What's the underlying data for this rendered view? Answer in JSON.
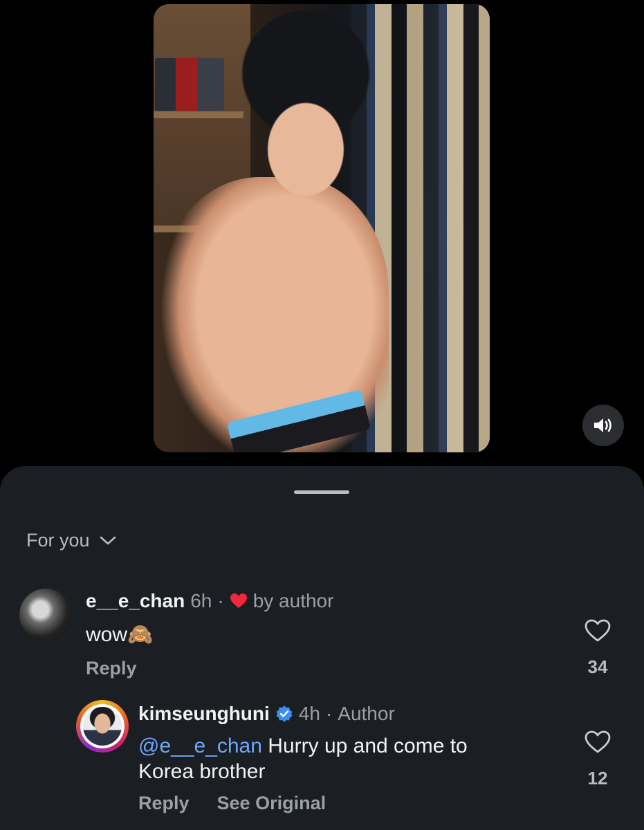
{
  "video": {
    "sound_icon": "speaker-icon"
  },
  "sheet": {
    "filter_label": "For you",
    "filter_icon": "chevron-down-icon"
  },
  "comments": [
    {
      "username": "e__e_chan",
      "time": "6h",
      "separator": "·",
      "liked_by": "by author",
      "text": "wow",
      "emoji": "🙈",
      "reply_label": "Reply",
      "like_count": "34"
    },
    {
      "username": "kimseunghuni",
      "verified": true,
      "time": "4h",
      "separator": "·",
      "badge": "Author",
      "mention": "@e__e_chan",
      "text": " Hurry up and come to Korea brother",
      "reply_label": "Reply",
      "see_original_label": "See Original",
      "like_count": "12"
    }
  ],
  "colors": {
    "sheet_bg": "#1b1e22",
    "mention": "#6ea7f7",
    "heart_red": "#f0283c",
    "verified_blue": "#3a8ef6"
  }
}
